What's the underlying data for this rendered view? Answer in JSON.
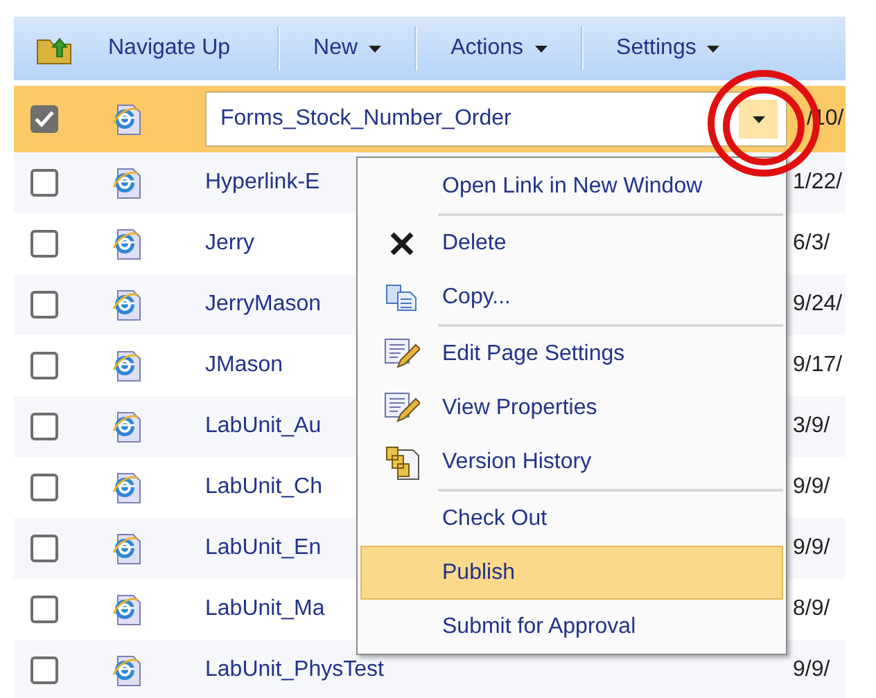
{
  "toolbar": {
    "items": [
      {
        "label": "Navigate Up",
        "kind": "navigate"
      },
      {
        "label": "New",
        "kind": "menu"
      },
      {
        "label": "Actions",
        "kind": "menu"
      },
      {
        "label": "Settings",
        "kind": "menu"
      }
    ]
  },
  "rows": [
    {
      "name": "Forms_Stock_Number_Order",
      "date": "/10/",
      "checked": true,
      "selected": true
    },
    {
      "name": "Hyperlink-E",
      "date": "1/22/",
      "checked": false,
      "selected": false
    },
    {
      "name": "Jerry",
      "date": "6/3/",
      "checked": false,
      "selected": false
    },
    {
      "name": "JerryMason",
      "date": "9/24/",
      "checked": false,
      "selected": false
    },
    {
      "name": "JMason",
      "date": "9/17/",
      "checked": false,
      "selected": false
    },
    {
      "name": "LabUnit_Au",
      "date": "3/9/",
      "checked": false,
      "selected": false
    },
    {
      "name": "LabUnit_Ch",
      "date": "9/9/",
      "checked": false,
      "selected": false
    },
    {
      "name": "LabUnit_En",
      "date": "9/9/",
      "checked": false,
      "selected": false
    },
    {
      "name": "LabUnit_Ma",
      "date": "8/9/",
      "checked": false,
      "selected": false
    },
    {
      "name": "LabUnit_PhysTest",
      "date": "9/9/",
      "checked": false,
      "selected": false
    }
  ],
  "context_menu": {
    "groups": [
      [
        {
          "label": "Open Link in New Window",
          "selected": false
        }
      ],
      [
        {
          "label": "Delete",
          "selected": false
        },
        {
          "label": "Copy...",
          "selected": false
        }
      ],
      [
        {
          "label": "Edit Page Settings",
          "selected": false
        },
        {
          "label": "View Properties",
          "selected": false
        },
        {
          "label": "Version History",
          "selected": false
        }
      ],
      [
        {
          "label": "Check Out",
          "selected": false
        },
        {
          "label": "Publish",
          "selected": true
        },
        {
          "label": "Submit for Approval",
          "selected": false
        }
      ]
    ]
  }
}
